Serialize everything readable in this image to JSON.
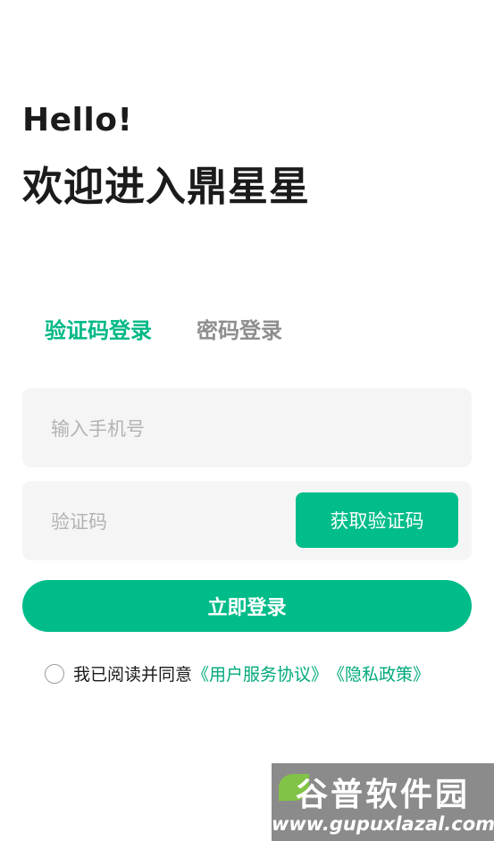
{
  "header": {
    "greeting": "Hello!",
    "welcome": "欢迎进入鼎星星"
  },
  "tabs": [
    {
      "label": "验证码登录",
      "active": true
    },
    {
      "label": "密码登录",
      "active": false
    }
  ],
  "phone_field": {
    "placeholder": "输入手机号",
    "value": ""
  },
  "code_field": {
    "placeholder": "验证码",
    "value": "",
    "button_label": "获取验证码"
  },
  "login_button": {
    "label": "立即登录"
  },
  "agreement": {
    "checked": false,
    "text": "我已阅读并同意",
    "user_agreement_link": "《用户服务协议》",
    "privacy_link": "《隐私政策》"
  },
  "watermark": {
    "title": "谷普软件园",
    "url": "www.gupuxlazal.com"
  },
  "colors": {
    "accent": "#00bc89",
    "link": "#00a97c",
    "field_bg": "#f5f5f5",
    "inactive_tab": "#8e8e8e"
  }
}
